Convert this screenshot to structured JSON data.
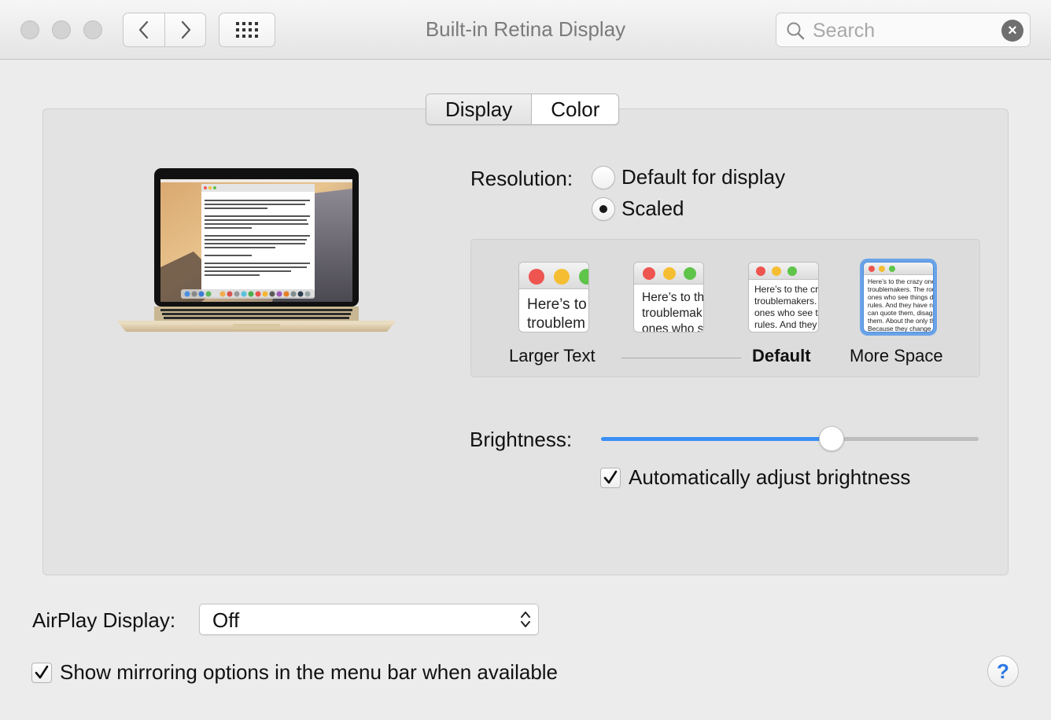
{
  "window": {
    "title": "Built-in Retina Display",
    "traffic_lights": [
      "close",
      "minimize",
      "zoom"
    ]
  },
  "toolbar": {
    "back_icon": "chevron-left-icon",
    "forward_icon": "chevron-right-icon",
    "grid_icon": "show-all-grid-icon",
    "search": {
      "placeholder": "Search",
      "value": ""
    }
  },
  "tabs": [
    {
      "label": "Display",
      "selected": true
    },
    {
      "label": "Color",
      "selected": false
    }
  ],
  "resolution": {
    "label": "Resolution:",
    "options": [
      {
        "label": "Default for display",
        "selected": false
      },
      {
        "label": "Scaled",
        "selected": true
      }
    ]
  },
  "scaled_options": [
    {
      "caption": "Larger Text",
      "preview_lines": [
        "Here’s to",
        "troublem"
      ],
      "selected": false
    },
    {
      "caption": "",
      "preview_lines": [
        "Here’s to th",
        "troublemak",
        "ones who s"
      ],
      "selected": false
    },
    {
      "caption": "Default",
      "preview_lines": [
        "Here’s to the cr",
        "troublemakers.",
        "ones who see t",
        "rules. And they"
      ],
      "selected": false
    },
    {
      "caption": "More Space",
      "preview_lines": [
        "Here’s to the crazy one",
        "troublemakers. The roun",
        "ones who see things dif",
        "rules. And they have no",
        "can quote them, disagre",
        "them. About the only th",
        "Because they change th"
      ],
      "selected": true
    }
  ],
  "brightness": {
    "label": "Brightness:",
    "value": 0.61,
    "accent_color": "#3b8ff7"
  },
  "auto_brightness": {
    "label": "Automatically adjust brightness",
    "checked": true
  },
  "airplay": {
    "label": "AirPlay Display:",
    "value": "Off"
  },
  "mirroring": {
    "label": "Show mirroring options in the menu bar when available",
    "checked": true
  },
  "help": {
    "label": "?"
  }
}
